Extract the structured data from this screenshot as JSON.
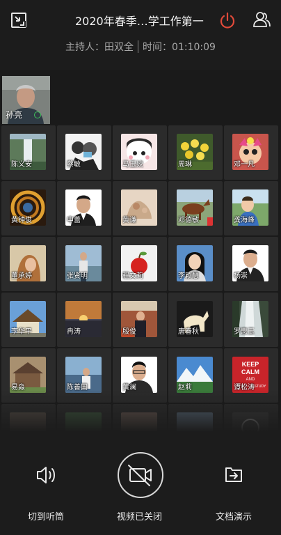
{
  "header": {
    "title": "2020年春季…学工作第一",
    "host_label": "主持人：",
    "host_name": "田双全",
    "time_label": "时间：",
    "time_value": "01:10:09"
  },
  "icons": {
    "exit_fullscreen": "exit-fullscreen-icon",
    "leave": "power-icon",
    "members": "members-icon",
    "audio": "speaker-icon",
    "video_off": "camera-off-icon",
    "share": "document-share-icon"
  },
  "colors": {
    "leave_button": "#e14a3a",
    "mic_active": "#3ec25a",
    "background": "#1a1a1a",
    "tile": "#2b2b2b"
  },
  "active_speaker": {
    "name": "孙亮"
  },
  "participants": [
    {
      "name": "陈义安"
    },
    {
      "name": "蔡敏"
    },
    {
      "name": "马玉姣"
    },
    {
      "name": "周琳"
    },
    {
      "name": "邓一凡"
    },
    {
      "name": "黄钟俊"
    },
    {
      "name": "申蕾"
    },
    {
      "name": "黄谦"
    },
    {
      "name": "邓德敏"
    },
    {
      "name": "龚海峰"
    },
    {
      "name": "董承婷"
    },
    {
      "name": "张贤明"
    },
    {
      "name": "程文莉"
    },
    {
      "name": "李颖慧"
    },
    {
      "name": "杨崇"
    },
    {
      "name": "李华平"
    },
    {
      "name": "冉涛"
    },
    {
      "name": "殷俊"
    },
    {
      "name": "唐春秋"
    },
    {
      "name": "罗惠玉"
    },
    {
      "name": "易淼"
    },
    {
      "name": "陈善国"
    },
    {
      "name": "黄澜"
    },
    {
      "name": "赵莉"
    },
    {
      "name": "谭松涛"
    }
  ],
  "poster_text": {
    "line1": "KEEP",
    "line2": "CALM",
    "line3": "AND",
    "line4": "STUDY"
  },
  "controls": {
    "audio_label": "切到听筒",
    "video_label": "视频已关闭",
    "share_label": "文档演示"
  }
}
